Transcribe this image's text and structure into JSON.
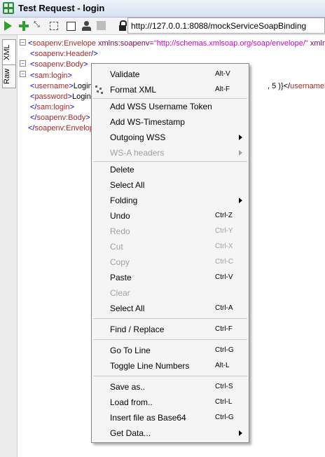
{
  "window": {
    "title": "Test Request - login"
  },
  "toolbar": {
    "url": "http://127.0.0.1:8088/mockServiceSoapBinding"
  },
  "side_tabs": {
    "xml": "XML",
    "raw": "Raw"
  },
  "editor": {
    "lines": [
      {
        "l": "<",
        "tag": "soapenv:Envelope",
        "mid": " xmlns:soapenv=",
        "val": "\"http://schemas.xmlsoap.org/soap/envelope/\"",
        "rest": " xmlns"
      },
      {
        "l": "<",
        "tag": "soapenv:Header",
        "r": "/>"
      },
      {
        "l": "<",
        "tag": "soapenv:Body",
        "r": ">"
      },
      {
        "l": "<",
        "tag": "sam:login",
        "r": ">"
      },
      {
        "l": "<",
        "tag": "username",
        "r": ">",
        "text": "Login",
        "tail1": ", 5 )}</",
        "tail2": "username",
        "tail3": ">"
      },
      {
        "l": "<",
        "tag": "password",
        "r": ">",
        "text": "Login"
      },
      {
        "l": "</",
        "tag": "sam:login",
        "r": ">"
      },
      {
        "l": "</",
        "tag": "soapenv:Body",
        "r": ">"
      },
      {
        "l": "</",
        "tag": "soapenv:Envelop"
      }
    ]
  },
  "context_menu": {
    "items": [
      {
        "label": "Validate",
        "shortcut": "Alt-V"
      },
      {
        "label": "Format XML",
        "shortcut": "Alt-F"
      },
      {
        "label": "Add WSS Username Token",
        "shortcut": ""
      },
      {
        "label": "Add WS-Timestamp",
        "shortcut": ""
      },
      {
        "label": "Outgoing WSS",
        "shortcut": ""
      },
      {
        "label": "WS-A headers",
        "shortcut": ""
      },
      {
        "label": "Delete",
        "shortcut": ""
      },
      {
        "label": "Select All",
        "shortcut": ""
      },
      {
        "label": "Folding",
        "shortcut": ""
      },
      {
        "label": "Undo",
        "shortcut": "Ctrl-Z"
      },
      {
        "label": "Redo",
        "shortcut": "Ctrl-Y"
      },
      {
        "label": "Cut",
        "shortcut": "Ctrl-X"
      },
      {
        "label": "Copy",
        "shortcut": "Ctrl-C"
      },
      {
        "label": "Paste",
        "shortcut": "Ctrl-V"
      },
      {
        "label": "Clear",
        "shortcut": ""
      },
      {
        "label": "Select All",
        "shortcut": "Ctrl-A"
      },
      {
        "label": "Find / Replace",
        "shortcut": "Ctrl-F"
      },
      {
        "label": "Go To Line",
        "shortcut": "Ctrl-G"
      },
      {
        "label": "Toggle Line Numbers",
        "shortcut": "Alt-L"
      },
      {
        "label": "Save as..",
        "shortcut": "Ctrl-S"
      },
      {
        "label": "Load from..",
        "shortcut": "Ctrl-L"
      },
      {
        "label": "Insert file as Base64",
        "shortcut": "Ctrl-G"
      },
      {
        "label": "Get Data...",
        "shortcut": ""
      }
    ]
  },
  "colors": {
    "tag": "#a52a2a",
    "bracket": "#0000cc",
    "attr_value": "#cc00cc",
    "accent_green": "#2da02d"
  }
}
